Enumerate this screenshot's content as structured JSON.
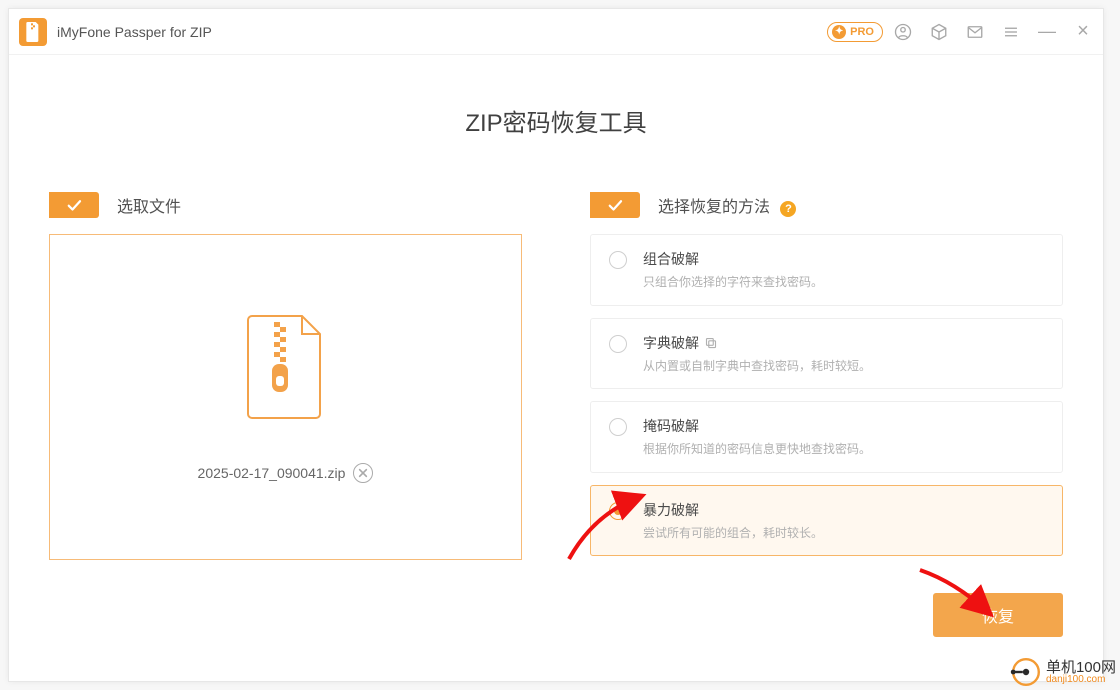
{
  "titlebar": {
    "app_name": "iMyFone Passper for ZIP",
    "pro_label": "PRO"
  },
  "heading": "ZIP密码恢复工具",
  "left": {
    "section_title": "选取文件",
    "file_name": "2025-02-17_090041.zip"
  },
  "right": {
    "section_title": "选择恢复的方法",
    "methods": [
      {
        "title": "组合破解",
        "desc": "只组合你选择的字符来查找密码。",
        "has_copy": false
      },
      {
        "title": "字典破解",
        "desc": "从内置或自制字典中查找密码，耗时较短。",
        "has_copy": true
      },
      {
        "title": "掩码破解",
        "desc": "根据你所知道的密码信息更快地查找密码。",
        "has_copy": false
      },
      {
        "title": "暴力破解",
        "desc": "尝试所有可能的组合，耗时较长。",
        "has_copy": false
      }
    ],
    "selected_index": 3
  },
  "recover_button": "恢复",
  "watermark": {
    "line1": "单机100网",
    "line2": "danji100.com"
  }
}
